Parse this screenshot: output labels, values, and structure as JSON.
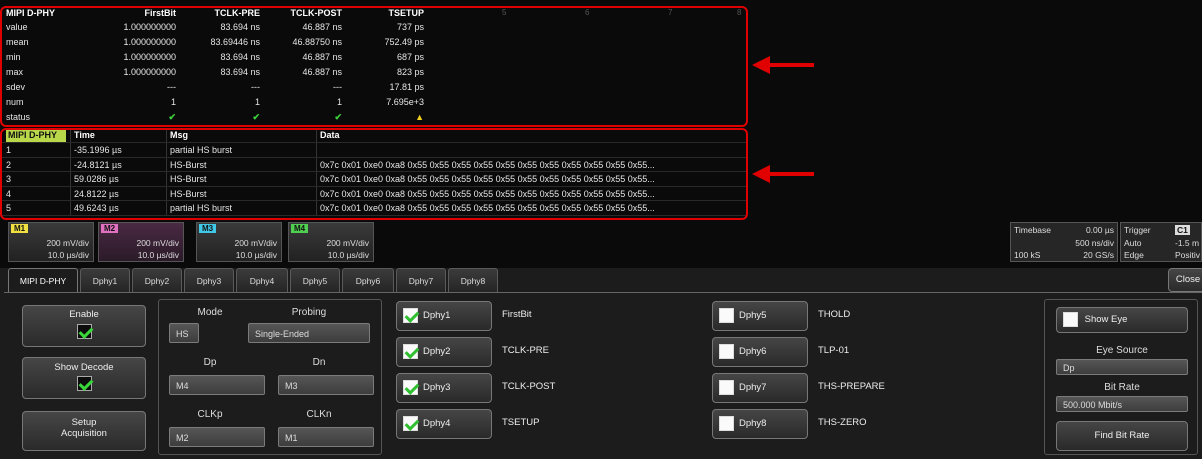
{
  "measurements": {
    "header": [
      "MIPI D-PHY",
      "FirstBit",
      "TCLK-PRE",
      "TCLK-POST",
      "TSETUP"
    ],
    "rows": [
      {
        "label": "value",
        "c1": "1.000000000",
        "c2": "83.694 ns",
        "c3": "46.887 ns",
        "c4": "737 ps"
      },
      {
        "label": "mean",
        "c1": "1.000000000",
        "c2": "83.69446 ns",
        "c3": "46.88750 ns",
        "c4": "752.49 ps"
      },
      {
        "label": "min",
        "c1": "1.000000000",
        "c2": "83.694 ns",
        "c3": "46.887 ns",
        "c4": "687 ps"
      },
      {
        "label": "max",
        "c1": "1.000000000",
        "c2": "83.694 ns",
        "c3": "46.887 ns",
        "c4": "823 ps"
      },
      {
        "label": "sdev",
        "c1": "---",
        "c2": "---",
        "c3": "---",
        "c4": "17.81 ps"
      },
      {
        "label": "num",
        "c1": "1",
        "c2": "1",
        "c3": "1",
        "c4": "7.695e+3"
      },
      {
        "label": "status",
        "c1": "✔",
        "c2": "✔",
        "c3": "✔",
        "c4": "▲"
      }
    ],
    "grid_numbers": [
      "5",
      "6",
      "7",
      "8"
    ]
  },
  "decode": {
    "header": [
      "MIPI D-PHY",
      "Time",
      "Msg",
      "Data"
    ],
    "rows": [
      {
        "idx": "1",
        "time": "-35.1996 µs",
        "msg": "partial HS burst",
        "data": ""
      },
      {
        "idx": "2",
        "time": "-24.8121 µs",
        "msg": "HS-Burst",
        "data": "0x7c 0x01 0xe0 0xa8 0x55 0x55 0x55 0x55 0x55 0x55 0x55 0x55 0x55 0x55 0x55..."
      },
      {
        "idx": "3",
        "time": "59.0286 µs",
        "msg": "HS-Burst",
        "data": "0x7c 0x01 0xe0 0xa8 0x55 0x55 0x55 0x55 0x55 0x55 0x55 0x55 0x55 0x55 0x55..."
      },
      {
        "idx": "4",
        "time": "24.8122 µs",
        "msg": "HS-Burst",
        "data": "0x7c 0x01 0xe0 0xa8 0x55 0x55 0x55 0x55 0x55 0x55 0x55 0x55 0x55 0x55 0x55..."
      },
      {
        "idx": "5",
        "time": "49.6243 µs",
        "msg": "partial HS burst",
        "data": "0x7c 0x01 0xe0 0xa8 0x55 0x55 0x55 0x55 0x55 0x55 0x55 0x55 0x55 0x55 0x55..."
      }
    ]
  },
  "channels": [
    {
      "tag": "M1",
      "color": "#f0e040",
      "volts": "200 mV/div",
      "time": "10.0 µs/div"
    },
    {
      "tag": "M2",
      "color": "#e070c0",
      "volts": "200 mV/div",
      "time": "10.0 µs/div"
    },
    {
      "tag": "M3",
      "color": "#40c8e8",
      "volts": "200 mV/div",
      "time": "10.0 µs/div"
    },
    {
      "tag": "M4",
      "color": "#50d050",
      "volts": "200 mV/div",
      "time": "10.0 µs/div"
    }
  ],
  "timebase": {
    "label": "Timebase",
    "delay": "0.00 µs",
    "div": "500 ns/div",
    "samples": "100 kS",
    "rate": "20 GS/s"
  },
  "trigger": {
    "label": "Trigger",
    "badge": "C1",
    "mode": "Auto",
    "level": "-1.5 m",
    "type": "Edge",
    "slope": "Positiv"
  },
  "tabs": [
    "MIPI D-PHY",
    "Dphy1",
    "Dphy2",
    "Dphy3",
    "Dphy4",
    "Dphy5",
    "Dphy6",
    "Dphy7",
    "Dphy8"
  ],
  "close_label": "Close",
  "left_panel": {
    "enable": "Enable",
    "show_decode": "Show Decode",
    "setup_line1": "Setup",
    "setup_line2": "Acquisition"
  },
  "config": {
    "mode_label": "Mode",
    "mode_value": "HS",
    "probing_label": "Probing",
    "probing_value": "Single-Ended",
    "dp_label": "Dp",
    "dp_value": "M4",
    "dn_label": "Dn",
    "dn_value": "M3",
    "clkp_label": "CLKp",
    "clkp_value": "M2",
    "clkn_label": "CLKn",
    "clkn_value": "M1"
  },
  "params": [
    {
      "name": "Dphy1",
      "checked": true,
      "param": "FirstBit"
    },
    {
      "name": "Dphy2",
      "checked": true,
      "param": "TCLK-PRE"
    },
    {
      "name": "Dphy3",
      "checked": true,
      "param": "TCLK-POST"
    },
    {
      "name": "Dphy4",
      "checked": true,
      "param": "TSETUP"
    },
    {
      "name": "Dphy5",
      "checked": false,
      "param": "THOLD"
    },
    {
      "name": "Dphy6",
      "checked": false,
      "param": "TLP-01"
    },
    {
      "name": "Dphy7",
      "checked": false,
      "param": "THS-PREPARE"
    },
    {
      "name": "Dphy8",
      "checked": false,
      "param": "THS-ZERO"
    }
  ],
  "eye": {
    "show_eye": "Show Eye",
    "source_label": "Eye Source",
    "source_value": "Dp",
    "bitrate_label": "Bit Rate",
    "bitrate_value": "500.000 Mbit/s",
    "find": "Find Bit Rate"
  },
  "colors": {
    "highlight": "#e00000",
    "check": "#39d53a",
    "warning": "#f0d020"
  }
}
